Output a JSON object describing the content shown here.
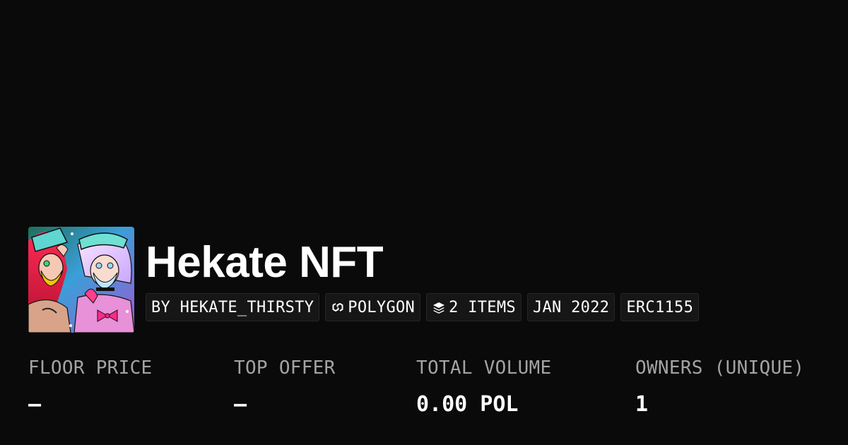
{
  "collection": {
    "name": "Hekate NFT",
    "avatar_icon": "anime-artwork-avatar"
  },
  "chips": [
    {
      "label": "BY HEKATE_THIRSTY",
      "icon": ""
    },
    {
      "label": "POLYGON",
      "icon": "polygon-chain-icon"
    },
    {
      "label": "2 ITEMS",
      "icon": "stack-layers-icon"
    },
    {
      "label": "JAN 2022",
      "icon": ""
    },
    {
      "label": "ERC1155",
      "icon": ""
    }
  ],
  "stats": [
    {
      "label": "FLOOR PRICE",
      "value": "–"
    },
    {
      "label": "TOP OFFER",
      "value": "–"
    },
    {
      "label": "TOTAL VOLUME",
      "value": "0.00 POL"
    },
    {
      "label": "OWNERS (UNIQUE)",
      "value": "1"
    }
  ],
  "colors": {
    "background": "#0a0a0a",
    "chip_background": "#161616",
    "label_gray": "#a3a3a3",
    "text": "#ffffff"
  }
}
